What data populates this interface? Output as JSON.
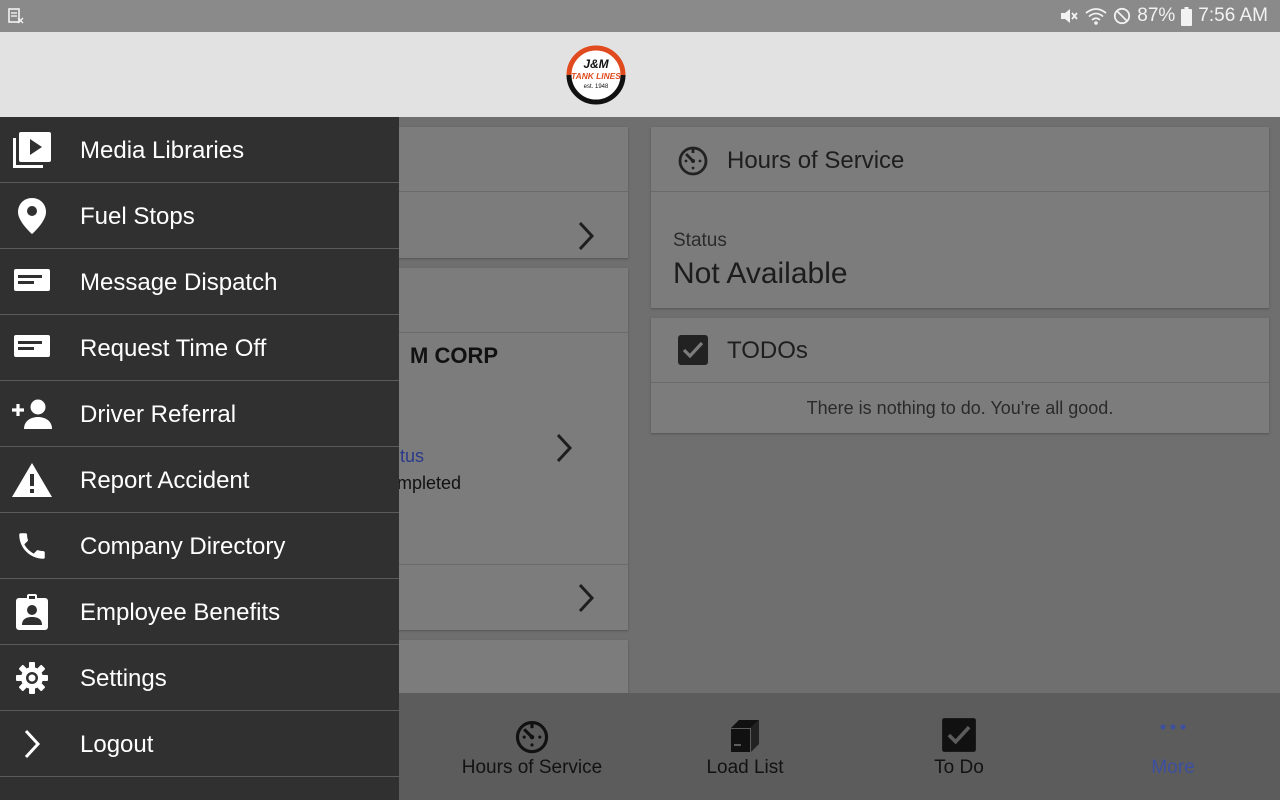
{
  "status_bar": {
    "battery": "87%",
    "time": "7:56 AM"
  },
  "brand": {
    "logo_text": "J&M",
    "logo_sub": "TANK LINES",
    "logo_est": "est. 1948",
    "logo_colors": {
      "ring": "#e04a1e",
      "dark": "#111111"
    }
  },
  "drawer": {
    "items": [
      {
        "label": "Media Libraries",
        "icon": "video-library-icon"
      },
      {
        "label": "Fuel Stops",
        "icon": "map-pin-icon"
      },
      {
        "label": "Message Dispatch",
        "icon": "message-icon"
      },
      {
        "label": "Request Time Off",
        "icon": "message-icon"
      },
      {
        "label": "Driver Referral",
        "icon": "person-add-icon"
      },
      {
        "label": "Report Accident",
        "icon": "warning-icon"
      },
      {
        "label": "Company Directory",
        "icon": "phone-icon"
      },
      {
        "label": "Employee Benefits",
        "icon": "badge-icon"
      },
      {
        "label": "Settings",
        "icon": "gear-icon"
      },
      {
        "label": "Logout",
        "icon": "chevron-right-icon"
      }
    ]
  },
  "main": {
    "load_card": {
      "customer": "M CORP",
      "status_link": "tus",
      "status_value": "mpleted"
    },
    "hos_card": {
      "title": "Hours of Service",
      "status_label": "Status",
      "status_value": "Not Available"
    },
    "todo_card": {
      "title": "TODOs",
      "empty_message": "There is nothing to do. You're all good."
    }
  },
  "bottom_nav": {
    "items": [
      {
        "label": "Hours of Service",
        "icon": "timer-icon"
      },
      {
        "label": "Load List",
        "icon": "box-icon"
      },
      {
        "label": "To Do",
        "icon": "checkbox-icon"
      },
      {
        "label": "More",
        "icon": "more-dots-icon",
        "active": true
      }
    ],
    "active_color": "#3d4fa0"
  }
}
